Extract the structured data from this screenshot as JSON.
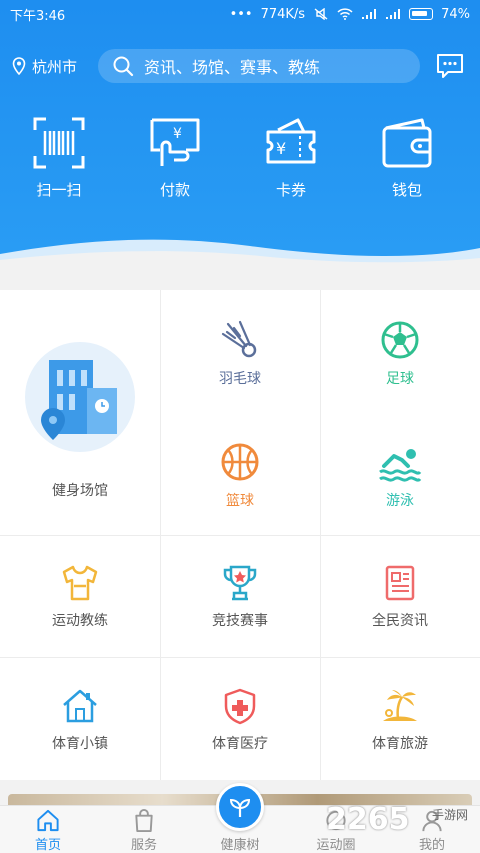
{
  "status_bar": {
    "time": "下午3:46",
    "speed": "774K/s",
    "battery": "74%"
  },
  "header": {
    "location": "杭州市",
    "search_placeholder": "资讯、场馆、赛事、教练",
    "quick_actions": [
      "扫一扫",
      "付款",
      "卡券",
      "钱包"
    ]
  },
  "grid": {
    "venue_label": "健身场馆",
    "sports": [
      {
        "label": "羽毛球",
        "color": "#5b6f9a",
        "icon": "badminton-icon"
      },
      {
        "label": "足球",
        "color": "#2fbf8f",
        "icon": "soccer-ball-icon"
      },
      {
        "label": "篮球",
        "color": "#f08a3c",
        "icon": "basketball-icon"
      },
      {
        "label": "游泳",
        "color": "#2fbfb0",
        "icon": "swimmer-icon"
      }
    ],
    "services": [
      {
        "label": "运动教练",
        "icon": "jersey-icon",
        "color": "#f2b63a"
      },
      {
        "label": "竞技赛事",
        "icon": "trophy-icon",
        "color": "#2aa7c9"
      },
      {
        "label": "全民资讯",
        "icon": "newspaper-icon",
        "color": "#ef6b6b"
      },
      {
        "label": "体育小镇",
        "icon": "house-icon",
        "color": "#2b9ee0"
      },
      {
        "label": "体育医疗",
        "icon": "medical-shield-icon",
        "color": "#ef5b5b"
      },
      {
        "label": "体育旅游",
        "icon": "palm-island-icon",
        "color": "#f2b63a"
      }
    ]
  },
  "tabbar": {
    "tabs": [
      "首页",
      "服务",
      "健康树",
      "运动圈",
      "我的"
    ],
    "active": "首页"
  },
  "watermark": {
    "brand": "2265",
    "site": "手游网"
  },
  "colors": {
    "primary": "#1e8ef0"
  }
}
